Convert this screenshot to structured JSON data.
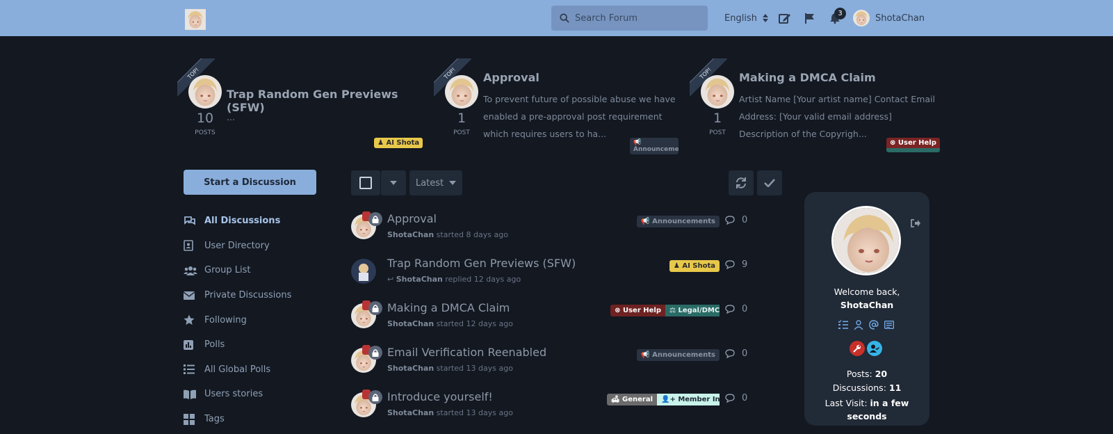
{
  "header": {
    "search_placeholder": "Search Forum",
    "language": "English",
    "notification_count": "3",
    "username": "ShotaChan"
  },
  "top_discussions": [
    {
      "ribbon": "TOP!",
      "title": "Trap Random Gen Previews (SFW)",
      "count": "10",
      "count_label": "POSTS",
      "excerpt": "...",
      "tags": [
        {
          "label": "AI Shota",
          "bg": "#e8c84a",
          "fg": "#2a2a2a"
        }
      ]
    },
    {
      "ribbon": "TOP!",
      "title": "Approval",
      "count": "1",
      "count_label": "POST",
      "excerpt": "To prevent future of possible abuse we have enabled a pre-approval post requirement which requires users to ha...",
      "tags": [
        {
          "label": "Announcemen",
          "bg": "#2a3342",
          "fg": "#8893a3"
        }
      ]
    },
    {
      "ribbon": "TOP!",
      "title": "Making a DMCA Claim",
      "count": "1",
      "count_label": "POST",
      "excerpt": "Artist Name [Your artist name] Contact Email Address: [Your valid email address] Description of the Copyrigh...",
      "tags": [
        {
          "label": "User Help",
          "bg": "#7a2424",
          "fg": "#ffffff"
        }
      ]
    }
  ],
  "start_button": "Start a Discussion",
  "nav": [
    {
      "label": "All Discussions",
      "icon": "comments-icon"
    },
    {
      "label": "User Directory",
      "icon": "address-book-icon"
    },
    {
      "label": "Group List",
      "icon": "users-icon"
    },
    {
      "label": "Private Discussions",
      "icon": "envelope-icon"
    },
    {
      "label": "Following",
      "icon": "star-icon"
    },
    {
      "label": "Polls",
      "icon": "poll-icon"
    },
    {
      "label": "All Global Polls",
      "icon": "list-icon"
    },
    {
      "label": "Users stories",
      "icon": "book-icon"
    },
    {
      "label": "Tags",
      "icon": "tags-icon"
    }
  ],
  "toolbar": {
    "sort_label": "Latest"
  },
  "discussions": [
    {
      "title": "Approval",
      "user": "ShotaChan",
      "action": "started 8 days ago",
      "replies": "0",
      "locked": true,
      "tags": [
        {
          "label": "Announcements",
          "bg": "#2a3342",
          "fg": "#8893a3",
          "icon": "megaphone-icon"
        }
      ]
    },
    {
      "title": "Trap Random Gen Previews (SFW)",
      "user": "ShotaChan",
      "action": "replied 12 days ago",
      "replies": "9",
      "locked": false,
      "tags": [
        {
          "label": "AI Shota",
          "bg": "#e8c84a",
          "fg": "#2a2a2a",
          "icon": "person-icon"
        }
      ]
    },
    {
      "title": "Making a DMCA Claim",
      "user": "ShotaChan",
      "action": "started 12 days ago",
      "replies": "0",
      "locked": true,
      "tags": [
        {
          "label": "User Help",
          "bg": "#6e2222",
          "fg": "#ffffff",
          "icon": "close-circle-icon"
        },
        {
          "label": "Legal/DMCA",
          "bg": "#2a6b66",
          "fg": "#e6f2f1",
          "icon": "scale-icon"
        }
      ]
    },
    {
      "title": "Email Verification Reenabled",
      "user": "ShotaChan",
      "action": "started 13 days ago",
      "replies": "0",
      "locked": true,
      "tags": [
        {
          "label": "Announcements",
          "bg": "#2a3342",
          "fg": "#8893a3",
          "icon": "megaphone-icon"
        }
      ]
    },
    {
      "title": "Introduce yourself!",
      "user": "ShotaChan",
      "action": "started 13 days ago",
      "replies": "0",
      "locked": true,
      "tags": [
        {
          "label": "General",
          "bg": "#6b6b6b",
          "fg": "#ffffff",
          "icon": "couch-icon"
        },
        {
          "label": "Member Introd",
          "bg": "#c8f2ea",
          "fg": "#1e2a33",
          "icon": "user-plus-icon"
        }
      ]
    }
  ],
  "sidebar_card": {
    "welcome": "Welcome back,",
    "username": "ShotaChan",
    "posts_label": "Posts:",
    "posts_value": "20",
    "discussions_label": "Discussions:",
    "discussions_value": "11",
    "last_visit_label": "Last Visit:",
    "last_visit_value": "in a few seconds"
  }
}
